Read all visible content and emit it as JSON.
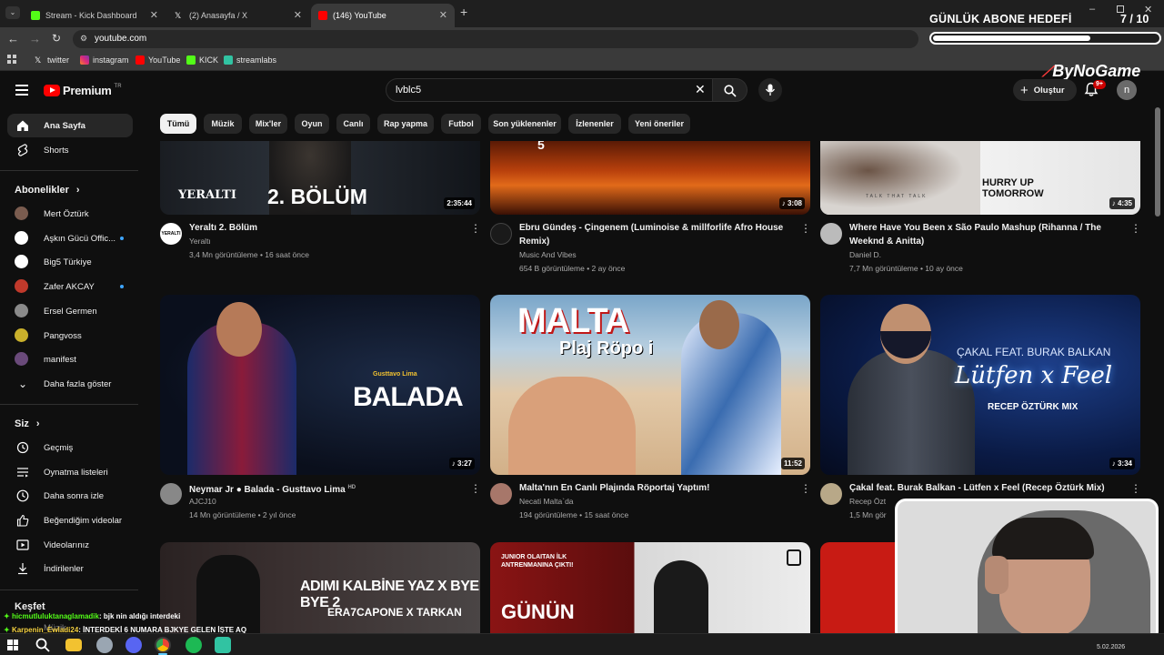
{
  "browser": {
    "tabs": [
      {
        "title": "Stream - Kick Dashboard",
        "icon": "kick-icon",
        "color": "#53fc18"
      },
      {
        "title": "(2) Anasayfa / X",
        "icon": "x-icon",
        "color": "#ffffff"
      },
      {
        "title": "(146) YouTube",
        "icon": "youtube-icon",
        "color": "#ff0000"
      }
    ],
    "url": "youtube.com",
    "bookmarks": [
      {
        "label": "twitter",
        "icon": "x-icon"
      },
      {
        "label": "instagram",
        "icon": "instagram-icon"
      },
      {
        "label": "YouTube",
        "icon": "youtube-icon"
      },
      {
        "label": "KICK",
        "icon": "kick-icon"
      },
      {
        "label": "streamlabs",
        "icon": "streamlabs-icon"
      }
    ]
  },
  "header": {
    "logo": "Premium",
    "logo_sup": "TR",
    "search_value": "lvblc5",
    "create_label": "Oluştur",
    "notif_count": "9+",
    "avatar_letter": "n"
  },
  "chips": [
    "Tümü",
    "Müzik",
    "Mix'ler",
    "Oyun",
    "Canlı",
    "Rap yapma",
    "Futbol",
    "Son yüklenenler",
    "İzlenenler",
    "Yeni öneriler"
  ],
  "sidebar": {
    "home": "Ana Sayfa",
    "shorts": "Shorts",
    "subs_title": "Abonelikler",
    "subs": [
      {
        "name": "Mert Öztürk",
        "color": "#7a5c4f",
        "live": false
      },
      {
        "name": "Aşkın Gücü Offic...",
        "color": "#ffffff",
        "live": true
      },
      {
        "name": "Big5 Türkiye",
        "color": "#ffffff",
        "live": false
      },
      {
        "name": "Zafer AKCAY",
        "color": "#c0392b",
        "live": true
      },
      {
        "name": "Ersel Germen",
        "color": "#8a8a8a",
        "live": false
      },
      {
        "name": "Pangvoss",
        "color": "#c9b02b",
        "live": false
      },
      {
        "name": "manifest",
        "color": "#6a4a7a",
        "live": false
      }
    ],
    "show_more": "Daha fazla göster",
    "you_title": "Siz",
    "you_items": [
      "Geçmiş",
      "Oynatma listeleri",
      "Daha sonra izle",
      "Beğendiğim videolar",
      "Videolarınız",
      "İndirilenler"
    ],
    "explore_title": "Keşfet",
    "explore_partial": "Müzik"
  },
  "videos": [
    {
      "title1": "Yeraltı 2. Bölüm",
      "title2": "",
      "channel": "Yeraltı",
      "meta": "3,4 Mn görüntüleme • 16 saat önce",
      "duration": "2:35:44",
      "thumb_text": "2. BÖLÜM",
      "thumb_sub": "YERALTI"
    },
    {
      "title1": "Ebru Gündeş - Çingenem (Luminoise & millforlife Afro House",
      "title2": "Remix)",
      "channel": "Music And Vibes",
      "meta": "654 B görüntüleme • 2 ay önce",
      "duration": "3:08",
      "thumb_text": "5",
      "thumb_sub": ""
    },
    {
      "title1": "Where Have You Been x São Paulo Mashup (Rihanna / The",
      "title2": "Weeknd & Anitta)",
      "channel": "Daniel D.",
      "meta": "7,7 Mn görüntüleme • 10 ay önce",
      "duration": "4:35",
      "thumb_text": "HURRY UP TOMORROW",
      "thumb_sub": "TALK THAT TALK"
    },
    {
      "title1": "Neymar Jr ● Balada - Gusttavo Lima",
      "title2": "",
      "badge": "HD",
      "channel": "AJCJ10",
      "meta": "14 Mn görüntüleme • 2 yıl önce",
      "duration": "3:27",
      "thumb_text": "BALADA",
      "thumb_sub": "Gusttavo Lima"
    },
    {
      "title1": "Malta'nın En Canlı Plajında Röportaj Yaptım!",
      "title2": "",
      "channel": "Necati Malta`da",
      "meta": "194 görüntüleme • 15 saat önce",
      "duration": "11:52",
      "thumb_text": "MALTA",
      "thumb_sub": "Plaj Röpo    i"
    },
    {
      "title1": "Çakal feat. Burak Balkan - Lütfen x Feel (Recep Öztürk Mix)",
      "title2": "",
      "channel": "Recep Özt",
      "meta": "1,5 Mn gör",
      "duration": "3:34",
      "thumb_text": "Lütfen x Feel",
      "thumb_sub": "ÇAKAL FEAT. BURAK BALKAN",
      "thumb_sub2": "RECEP ÖZTÜRK MIX"
    },
    {
      "thumb_text": "ADIMI KALBİNE YAZ X BYE BYE 2",
      "thumb_sub": "ERA7CAPONE X TARKAN"
    },
    {
      "thumb_text": "GÜNÜN",
      "thumb_sub": "JUNIOR OLAITAN İLK ANTRENMANINA ÇIKTI!"
    }
  ],
  "overlay": {
    "goal_title": "GÜNLÜK ABONE HEDEFİ",
    "goal_count": "7  / 10",
    "goal_fraction": 0.7,
    "sponsor": "ByNoGame",
    "chat": [
      {
        "user": "hicmutluluktanaglamadik",
        "msg": ": bjk nin aldığı interdeki"
      },
      {
        "user": "Karpenin_Ewladi24",
        "msg": ": İNTERDEKİ 6 NUMARA BJKYE GELEN İŞTE AQ"
      }
    ]
  },
  "taskbar": {
    "date": "5.02.2026"
  }
}
